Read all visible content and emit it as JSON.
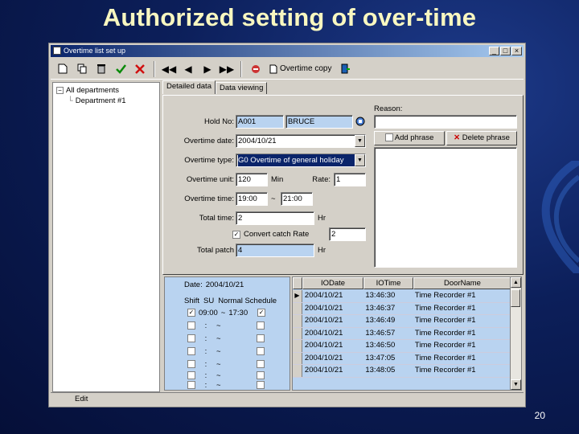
{
  "slide": {
    "title": "Authorized setting of over-time",
    "page_number": "20"
  },
  "window": {
    "title": "Overtime list set up"
  },
  "toolbar": {
    "overtime_copy_label": "Overtime copy"
  },
  "tree": {
    "root": "All departments",
    "child": "Department #1"
  },
  "tabs": [
    {
      "label": "Detailed data"
    },
    {
      "label": "Data viewing"
    }
  ],
  "form": {
    "hold_no_label": "Hold No:",
    "hold_no": "A001",
    "holder_name": "BRUCE",
    "overtime_date_label": "Overtime date:",
    "overtime_date": "2004/10/21",
    "overtime_type_label": "Overtime type:",
    "overtime_type": "G0 Overtime of general holiday",
    "overtime_unit_label": "Overtime unit:",
    "overtime_unit": "120",
    "min_label": "Min",
    "rate_label": "Rate:",
    "rate": "1",
    "overtime_time_label": "Overtime time:",
    "time_from": "19:00",
    "time_sep": "~",
    "time_to": "21:00",
    "total_time_label": "Total time:",
    "total_time": "2",
    "hr_label": "Hr",
    "convert_label": "Convert catch Rate",
    "convert_value": "2",
    "total_patch_label": "Total patch",
    "total_patch": "4",
    "hr2_label": "Hr",
    "reason_label": "Reason:",
    "add_phrase": "Add phrase",
    "delete_phrase": "Delete phrase"
  },
  "schedule": {
    "date_label": "Date:",
    "date": "2004/10/21",
    "shift_label": "Shift",
    "shift_code": "SU",
    "normal_label": "Normal Schedule",
    "first_from": "09:00",
    "first_sep": "~",
    "first_to": "17:30",
    "blank_rows": [
      ":",
      ":",
      ":",
      ":",
      ":",
      ":"
    ],
    "blank_seps": [
      "~",
      "~",
      "~",
      "~",
      "~",
      "~"
    ]
  },
  "grid": {
    "columns": [
      "IODate",
      "IOTime",
      "DoorName"
    ],
    "rows": [
      [
        "2004/10/21",
        "13:46:30",
        "Time Recorder #1"
      ],
      [
        "2004/10/21",
        "13:46:37",
        "Time Recorder #1"
      ],
      [
        "2004/10/21",
        "13:46:49",
        "Time Recorder #1"
      ],
      [
        "2004/10/21",
        "13:46:57",
        "Time Recorder #1"
      ],
      [
        "2004/10/21",
        "13:46:50",
        "Time Recorder #1"
      ],
      [
        "2004/10/21",
        "13:47:05",
        "Time Recorder #1"
      ],
      [
        "2004/10/21",
        "13:48:05",
        "Time Recorder #1"
      ]
    ]
  },
  "status": {
    "text": "Edit"
  }
}
